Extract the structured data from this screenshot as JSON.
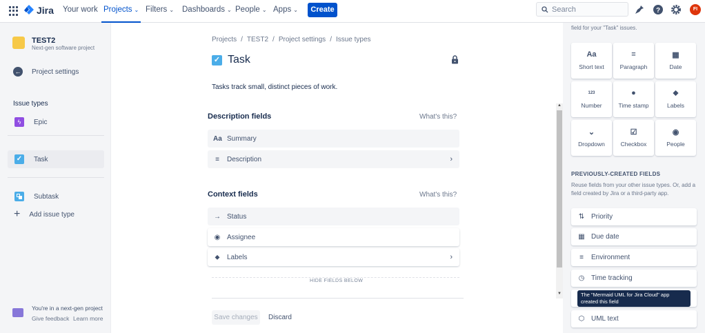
{
  "topbar": {
    "app_name": "Jira",
    "nav": [
      {
        "label": "Your work",
        "has_chevron": false,
        "active": false
      },
      {
        "label": "Projects",
        "has_chevron": true,
        "active": true
      },
      {
        "label": "Filters",
        "has_chevron": true,
        "active": false
      },
      {
        "label": "Dashboards",
        "has_chevron": true,
        "active": false
      },
      {
        "label": "People",
        "has_chevron": true,
        "active": false
      },
      {
        "label": "Apps",
        "has_chevron": true,
        "active": false
      }
    ],
    "create_label": "Create",
    "search_placeholder": "Search",
    "avatar_initials": "FI",
    "brand_color": "#0052cc"
  },
  "sidebar": {
    "project_name": "TEST2",
    "project_type": "Next-gen software project",
    "back_label": "Project settings",
    "section_heading": "Issue types",
    "issue_types": [
      {
        "label": "Epic",
        "icon": "epic-icon",
        "color": "#904ee2",
        "selected": false
      },
      {
        "label": "Task",
        "icon": "task-icon",
        "color": "#4bade8",
        "selected": true
      },
      {
        "label": "Subtask",
        "icon": "subtask-icon",
        "color": "#4bade8",
        "selected": false
      }
    ],
    "add_label": "Add issue type",
    "nextgen_text": "You're in a next-gen project",
    "feedback_label": "Give feedback",
    "learn_label": "Learn more"
  },
  "main": {
    "breadcrumb": [
      "Projects",
      "TEST2",
      "Project settings",
      "Issue types"
    ],
    "title": "Task",
    "description": "Tasks track small, distinct pieces of work.",
    "description_fields": {
      "heading": "Description fields",
      "whats_this": "What's this?",
      "fields": [
        {
          "label": "Summary",
          "icon": "Aa",
          "chevron": false
        },
        {
          "label": "Description",
          "icon": "≡",
          "chevron": true
        }
      ]
    },
    "context_fields": {
      "heading": "Context fields",
      "whats_this": "What's this?",
      "fields": [
        {
          "label": "Status",
          "icon": "→",
          "chevron": false
        },
        {
          "label": "Assignee",
          "icon": "◉",
          "chevron": false
        },
        {
          "label": "Labels",
          "icon": "⬥",
          "chevron": true
        }
      ]
    },
    "hide_fields_label": "HIDE FIELDS BELOW",
    "save_label": "Save changes",
    "discard_label": "Discard"
  },
  "right_panel": {
    "intro": "field for your \"Task\" issues.",
    "field_types": [
      {
        "label": "Short text",
        "icon": "Aa"
      },
      {
        "label": "Paragraph",
        "icon": "≡"
      },
      {
        "label": "Date",
        "icon": "▦"
      },
      {
        "label": "Number",
        "icon": "123"
      },
      {
        "label": "Time stamp",
        "icon": "●"
      },
      {
        "label": "Labels",
        "icon": "⬥"
      },
      {
        "label": "Dropdown",
        "icon": "⌄"
      },
      {
        "label": "Checkbox",
        "icon": "☑"
      },
      {
        "label": "People",
        "icon": "◉"
      }
    ],
    "previous_heading": "PREVIOUSLY-CREATED FIELDS",
    "previous_sub": "Reuse fields from your other issue types. Or, add a field created by Jira or a third-party app.",
    "previous_fields": [
      {
        "label": "Priority",
        "icon": "⇅"
      },
      {
        "label": "Due date",
        "icon": "▦"
      },
      {
        "label": "Environment",
        "icon": "≡"
      },
      {
        "label": "Time tracking",
        "icon": "◷"
      },
      {
        "label": "",
        "icon": ""
      },
      {
        "label": "UML text",
        "icon": "⬡"
      }
    ],
    "tooltip": "The \"Mermaid UML for Jira Cloud\" app created this field"
  }
}
